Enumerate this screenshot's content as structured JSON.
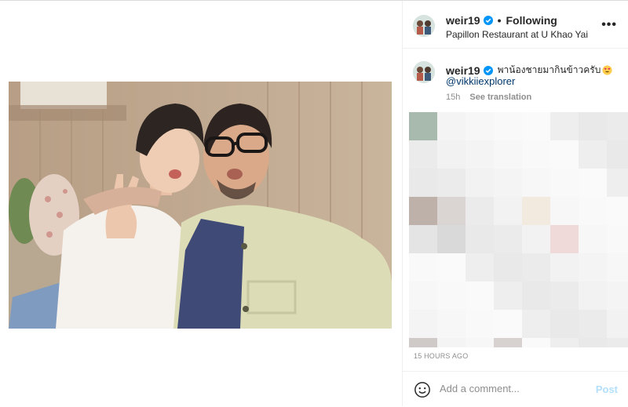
{
  "post": {
    "username": "weir19",
    "separator": "•",
    "follow_status": "Following",
    "location": "Papillon Restaurant at U Khao Yai",
    "more_icon": "more-horizontal-icon",
    "more_text": "•••"
  },
  "caption": {
    "username": "weir19",
    "text": "พาน้องชายมากินข้าวครับ",
    "emoji": "heart-eyes-emoji",
    "mention": "@vikkiiexplorer",
    "time": "15h",
    "see_translation": "See translation"
  },
  "timestamp": "15 HOURS AGO",
  "comment_box": {
    "placeholder": "Add a comment...",
    "post_label": "Post",
    "emoji_icon": "smiley-icon"
  },
  "colors": {
    "link": "#00376b",
    "muted": "#8e8e8e",
    "post_disabled": "#b2dffc",
    "verified": "#0095f6"
  }
}
